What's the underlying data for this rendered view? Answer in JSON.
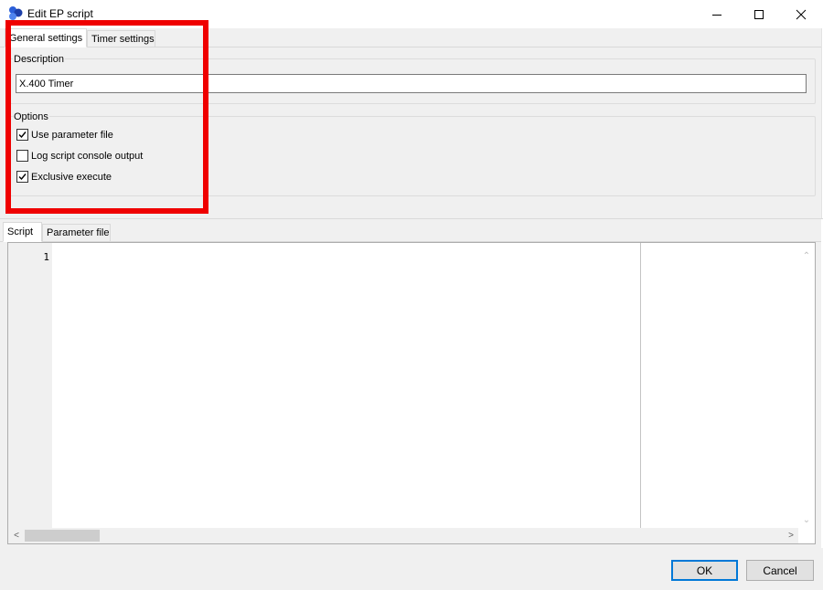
{
  "window": {
    "title": "Edit EP script",
    "minimize_icon": "minimize-icon",
    "maximize_icon": "maximize-icon",
    "close_icon": "close-icon"
  },
  "upper_tabs": [
    {
      "label": "General settings",
      "active": true
    },
    {
      "label": "Timer settings",
      "active": false
    }
  ],
  "general": {
    "description_label": "Description",
    "description_value": "X.400 Timer",
    "options_label": "Options",
    "options": [
      {
        "label": "Use parameter file",
        "checked": true
      },
      {
        "label": "Log script console output",
        "checked": false
      },
      {
        "label": "Exclusive execute",
        "checked": true
      }
    ]
  },
  "lower_tabs": [
    {
      "label": "Script",
      "active": true
    },
    {
      "label": "Parameter file",
      "active": false
    }
  ],
  "editor": {
    "line_numbers": [
      "1"
    ],
    "content": ""
  },
  "buttons": {
    "ok": "OK",
    "cancel": "Cancel"
  },
  "colors": {
    "annotation": "#ef0000",
    "default_button_border": "#0078d7"
  }
}
